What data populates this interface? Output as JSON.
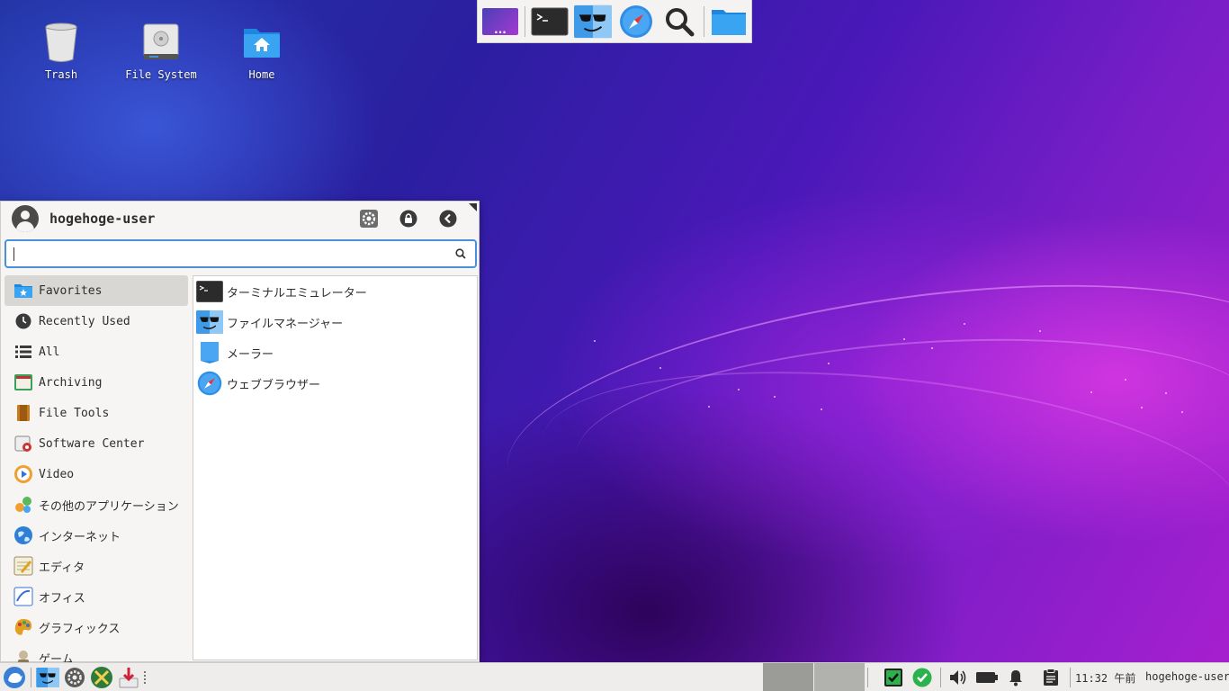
{
  "desktop": {
    "icons": [
      {
        "label": "Trash",
        "icon": "trash-icon"
      },
      {
        "label": "File System",
        "icon": "drive-icon"
      },
      {
        "label": "Home",
        "icon": "home-folder-icon"
      }
    ]
  },
  "top_dock": {
    "items": [
      "workspaces-icon",
      "terminal-icon",
      "file-manager-icon",
      "browser-icon",
      "search-icon",
      "folder-icon"
    ],
    "workspace_label": "..."
  },
  "menu": {
    "username": "hogehoge-user",
    "search": {
      "value": "",
      "placeholder": ""
    },
    "header_buttons": [
      "settings-icon",
      "lock-icon",
      "back-icon"
    ],
    "categories": [
      {
        "label": "Favorites",
        "selected": true
      },
      {
        "label": "Recently Used"
      },
      {
        "label": "All"
      },
      {
        "label": "Archiving"
      },
      {
        "label": "File Tools"
      },
      {
        "label": "Software Center"
      },
      {
        "label": "Video"
      },
      {
        "label": "その他のアプリケーション"
      },
      {
        "label": "インターネット"
      },
      {
        "label": "エディタ"
      },
      {
        "label": "オフィス"
      },
      {
        "label": "グラフィックス"
      },
      {
        "label": "ゲーム"
      }
    ],
    "apps": [
      {
        "label": "ターミナルエミュレーター"
      },
      {
        "label": "ファイルマネージャー"
      },
      {
        "label": "メーラー"
      },
      {
        "label": "ウェブブラウザー"
      }
    ]
  },
  "taskbar": {
    "clock": "11:32 午前",
    "user": "hogehoge-user",
    "colors": {
      "accent": "#4a90d9",
      "check_green": "#2bb24c"
    }
  }
}
